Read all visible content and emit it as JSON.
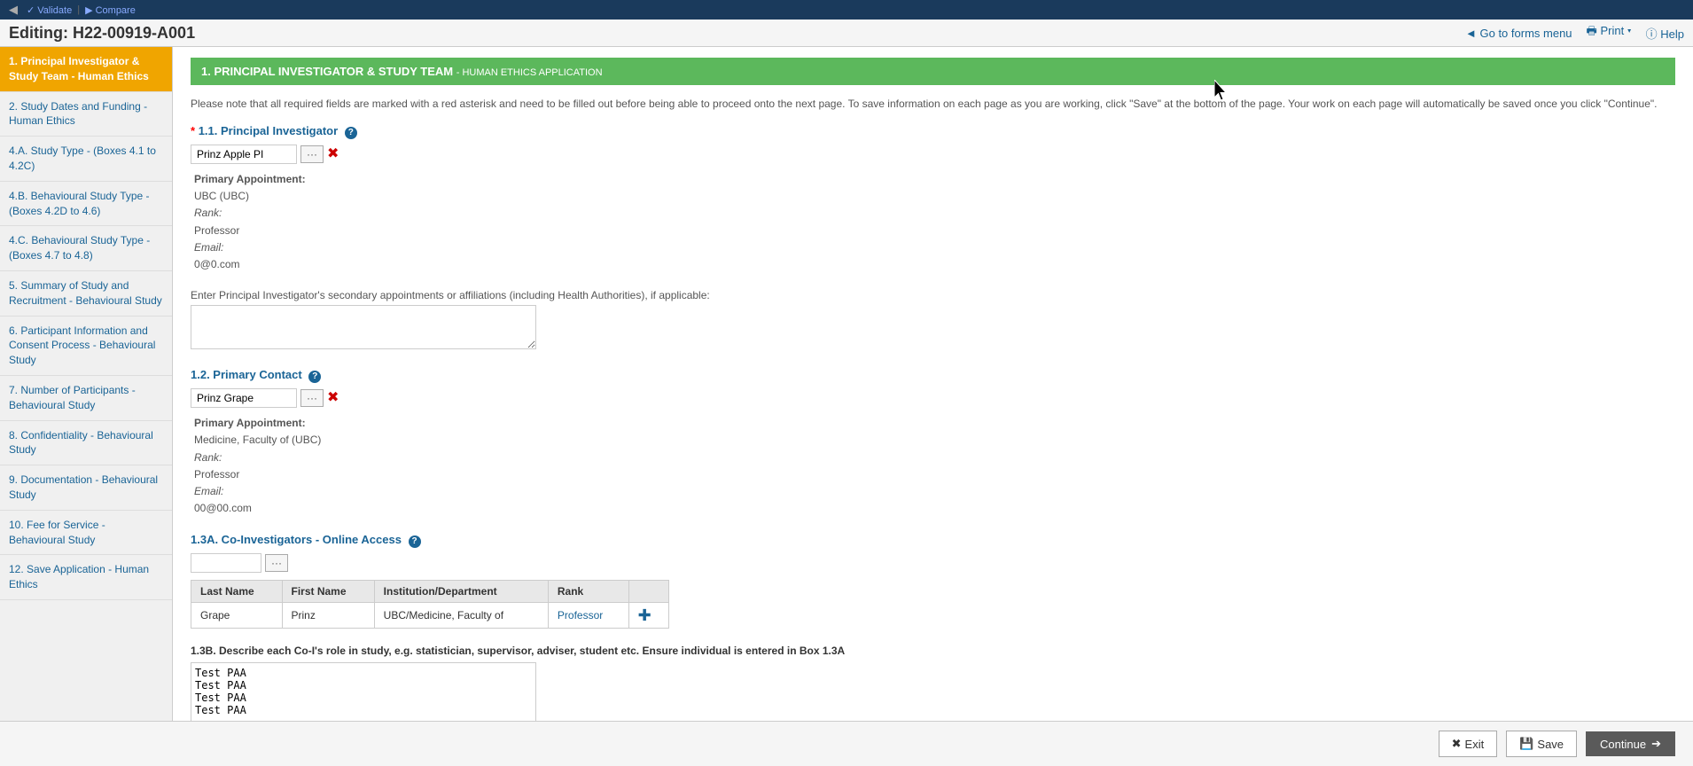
{
  "topBar": {
    "validateLabel": "Validate",
    "compareLabel": "Compare"
  },
  "header": {
    "title": "Editing: H22-00919-A001",
    "goToFormsMenu": "◄ Go to forms menu",
    "printLabel": "Print ▾",
    "helpLabel": "Help"
  },
  "sidebar": {
    "items": [
      {
        "id": "item-1",
        "label": "1. Principal Investigator & Study Team - Human Ethics",
        "active": true
      },
      {
        "id": "item-2",
        "label": "2. Study Dates and Funding - Human Ethics"
      },
      {
        "id": "item-4a",
        "label": "4.A. Study Type - (Boxes 4.1 to 4.2C)"
      },
      {
        "id": "item-4b",
        "label": "4.B. Behavioural Study Type - (Boxes 4.2D to 4.6)"
      },
      {
        "id": "item-4c",
        "label": "4.C. Behavioural Study Type - (Boxes 4.7 to 4.8)"
      },
      {
        "id": "item-5",
        "label": "5. Summary of Study and Recruitment - Behavioural Study"
      },
      {
        "id": "item-6",
        "label": "6. Participant Information and Consent Process - Behavioural Study"
      },
      {
        "id": "item-7",
        "label": "7. Number of Participants - Behavioural Study"
      },
      {
        "id": "item-8",
        "label": "8. Confidentiality - Behavioural Study"
      },
      {
        "id": "item-9",
        "label": "9. Documentation - Behavioural Study"
      },
      {
        "id": "item-10",
        "label": "10. Fee for Service - Behavioural Study"
      },
      {
        "id": "item-12",
        "label": "12. Save Application - Human Ethics"
      }
    ]
  },
  "sectionHeader": {
    "title": "1. PRINCIPAL INVESTIGATOR & STUDY TEAM",
    "subtitle": "- HUMAN ETHICS APPLICATION"
  },
  "infoText": "Please note that all required fields are marked with a red asterisk and need to be filled out before being able to proceed onto the next page. To save information on each page as you are working, click \"Save\" at the bottom of the page. Your work on each page will automatically be saved once you click \"Continue\".",
  "principalInvestigator": {
    "sectionLabel": "1.1. Principal Investigator",
    "requiredMark": "*",
    "value": "Prinz Apple PI",
    "dotsBtn": "···",
    "primaryAppointmentLabel": "Primary Appointment:",
    "primaryAppointmentValue": "UBC (UBC)",
    "rankLabel": "Rank:",
    "rankValue": "Professor",
    "emailLabel": "Email:",
    "emailValue": "0@0.com"
  },
  "secondaryAppointments": {
    "label": "Enter Principal Investigator's secondary appointments or affiliations (including Health Authorities), if applicable:",
    "value": ""
  },
  "primaryContact": {
    "sectionLabel": "1.2. Primary Contact",
    "value": "Prinz Grape",
    "dotsBtn": "···",
    "primaryAppointmentLabel": "Primary Appointment:",
    "primaryAppointmentValue": "Medicine, Faculty of (UBC)",
    "rankLabel": "Rank:",
    "rankValue": "Professor",
    "emailLabel": "Email:",
    "emailValue": "00@00.com"
  },
  "coInvestigators": {
    "sectionLabel": "1.3A. Co-Investigators - Online Access",
    "dotsBtn": "···",
    "tableHeaders": [
      "Last Name",
      "First Name",
      "Institution/Department",
      "Rank"
    ],
    "tableRows": [
      {
        "lastName": "Grape",
        "firstName": "Prinz",
        "institution": "UBC/Medicine, Faculty of",
        "rank": "Professor"
      }
    ]
  },
  "coInvestigatorsRole": {
    "sectionLabel": "1.3B. Describe each Co-I's role in study, e.g. statistician, supervisor, adviser, student etc. Ensure individual is entered in Box 1.3A",
    "value": "Test PAA\nTest PAA\nTest PAA\nTest PAA"
  },
  "actionBar": {
    "exitLabel": "Exit",
    "saveLabel": "Save",
    "continueLabel": "Continue"
  }
}
